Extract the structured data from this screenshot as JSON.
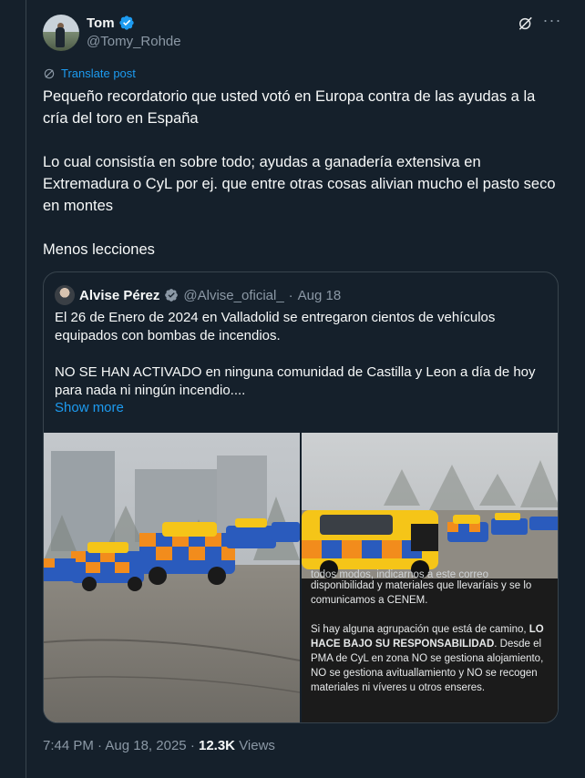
{
  "author": {
    "name": "Tom",
    "handle": "@Tomy_Rohde"
  },
  "translate_label": "Translate post",
  "tweet_paragraphs": [
    "Pequeño recordatorio que usted votó en Europa contra de las ayudas a la cría del toro en España",
    "Lo cual consistía en sobre todo; ayudas a ganadería extensiva en Extremadura o CyL por ej. que entre otras cosas alivian mucho el pasto seco en montes",
    "Menos lecciones"
  ],
  "quote": {
    "name": "Alvise Pérez",
    "handle": "@Alvise_oficial_",
    "separator": "·",
    "date": "Aug 18",
    "paragraphs": [
      "El 26 de Enero de 2024 en Valladolid se entregaron cientos de vehículos equipados con bombas de incendios.",
      "NO SE HAN ACTIVADO en ninguna comunidad de Castilla y Leon a día de hoy para nada ni ningún incendio...."
    ],
    "show_more": "Show more",
    "image_notice": {
      "cut_line": "todos modos, indicarnos a este correo",
      "p1": "disponibilidad y materiales que llevaríais y se lo comunicamos a CENEM.",
      "p2_lead": "Si hay alguna agrupación que está de camino,",
      "p2_bold": "LO HACE BAJO SU RESPONSABILIDAD",
      "p2_rest": ". Desde el PMA de CyL en zona NO se gestiona alojamiento, NO se gestiona avituallamiento y NO se recogen materiales ni víveres u otros enseres."
    }
  },
  "footer": {
    "time": "7:44 PM",
    "separator": "·",
    "date": "Aug 18, 2025",
    "separator2": "·",
    "views_count": "12.3K",
    "views_label": "Views"
  },
  "colors": {
    "background": "#15202b",
    "accent": "#1d9bf0",
    "muted": "#8b98a5",
    "border": "#38444d"
  },
  "icons": [
    "verified-badge-icon",
    "grok-icon",
    "more-icon",
    "translate-icon"
  ]
}
